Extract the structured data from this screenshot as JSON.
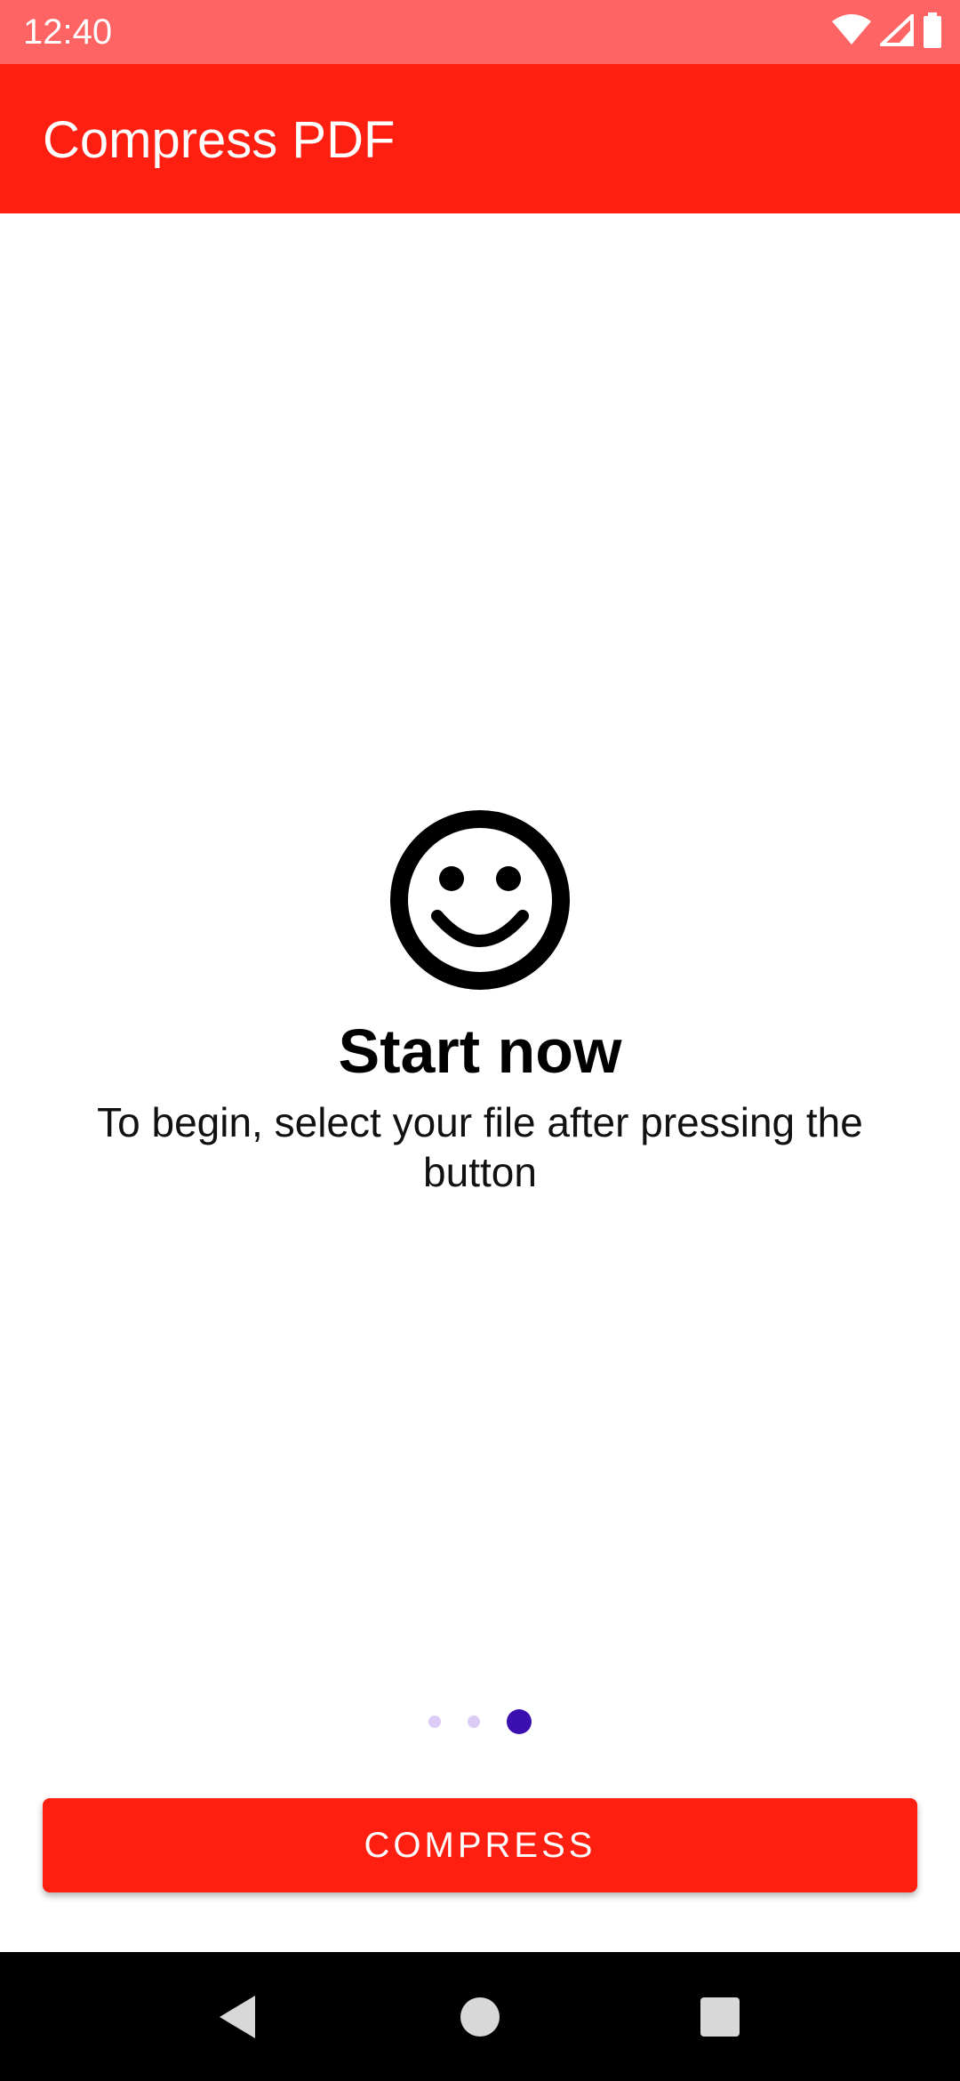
{
  "status_bar": {
    "time": "12:40",
    "icons": [
      "wifi-icon",
      "signal-icon",
      "battery-icon"
    ]
  },
  "app_bar": {
    "title": "Compress PDF"
  },
  "main": {
    "icon": "smiley-face-icon",
    "headline": "Start now",
    "subtext": "To begin, select your file after pressing the button",
    "pager": {
      "total": 3,
      "active_index": 2
    },
    "compress_label": "COMPRESS"
  },
  "nav_bar": {
    "icons": [
      "back-icon",
      "home-icon",
      "recents-icon"
    ]
  },
  "colors": {
    "status_bar": "#ff6464",
    "app_bar": "#ff1f10",
    "button": "#ff1f10",
    "dot_active": "#3a0fb0",
    "dot_inactive": "#dccbf5"
  }
}
